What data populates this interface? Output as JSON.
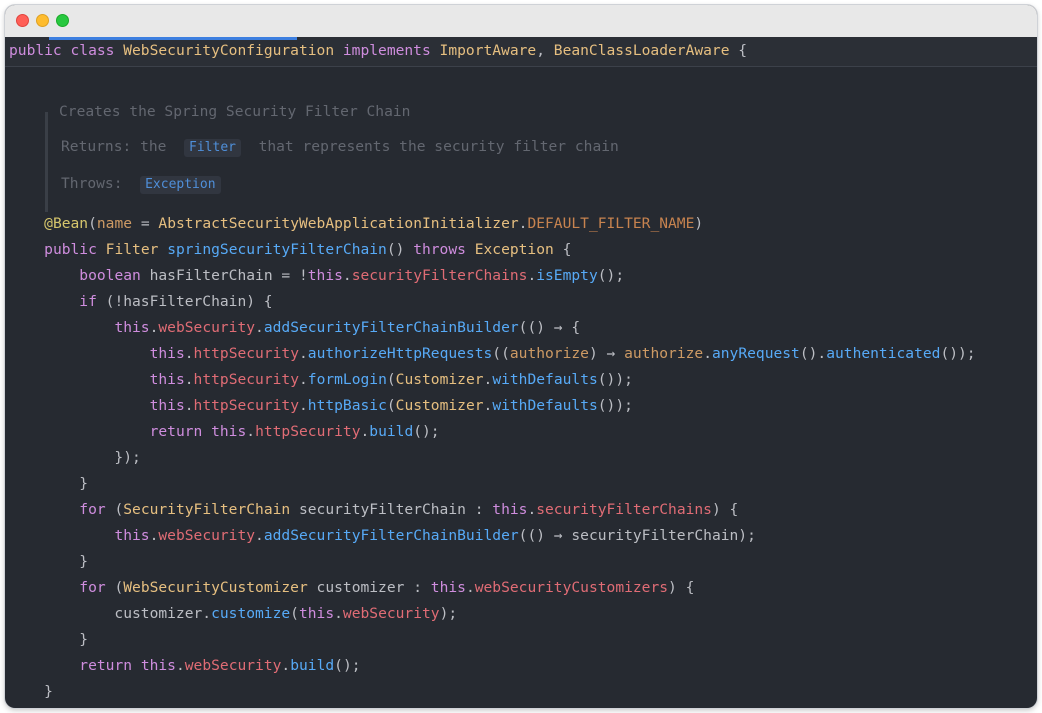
{
  "window": {
    "controls": [
      "close",
      "minimize",
      "zoom"
    ]
  },
  "sticky_header": {
    "tokens": [
      {
        "t": "public class ",
        "c": "kw"
      },
      {
        "t": "WebSecurityConfiguration",
        "c": "cls"
      },
      {
        "t": " implements ",
        "c": "kw"
      },
      {
        "t": "ImportAware",
        "c": "cls"
      },
      {
        "t": ", ",
        "c": "plain"
      },
      {
        "t": "BeanClassLoaderAware",
        "c": "cls"
      },
      {
        "t": " {",
        "c": "plain"
      }
    ]
  },
  "doc": {
    "summary": "Creates the Spring Security Filter Chain",
    "returns_label": "Returns:",
    "returns_pre": "the",
    "returns_chip": "Filter",
    "returns_post": "that represents the security filter chain",
    "throws_label": "Throws:",
    "throws_chip": "Exception"
  },
  "code_lines": [
    [
      {
        "t": "    ",
        "c": "plain"
      },
      {
        "t": "@Bean",
        "c": "ann"
      },
      {
        "t": "(",
        "c": "plain"
      },
      {
        "t": "name",
        "c": "param"
      },
      {
        "t": " = ",
        "c": "plain"
      },
      {
        "t": "AbstractSecurityWebApplicationInitializer",
        "c": "cls"
      },
      {
        "t": ".",
        "c": "plain"
      },
      {
        "t": "DEFAULT_FILTER_NAME",
        "c": "const"
      },
      {
        "t": ")",
        "c": "plain"
      }
    ],
    [
      {
        "t": "    ",
        "c": "plain"
      },
      {
        "t": "public ",
        "c": "kw"
      },
      {
        "t": "Filter",
        "c": "cls"
      },
      {
        "t": " ",
        "c": "plain"
      },
      {
        "t": "springSecurityFilterChain",
        "c": "fn"
      },
      {
        "t": "() ",
        "c": "plain"
      },
      {
        "t": "throws ",
        "c": "kw"
      },
      {
        "t": "Exception",
        "c": "cls"
      },
      {
        "t": " {",
        "c": "plain"
      }
    ],
    [
      {
        "t": "        ",
        "c": "plain"
      },
      {
        "t": "boolean ",
        "c": "kw"
      },
      {
        "t": "hasFilterChain = !",
        "c": "plain"
      },
      {
        "t": "this",
        "c": "kw"
      },
      {
        "t": ".",
        "c": "plain"
      },
      {
        "t": "securityFilterChains",
        "c": "fld2"
      },
      {
        "t": ".",
        "c": "plain"
      },
      {
        "t": "isEmpty",
        "c": "fn"
      },
      {
        "t": "();",
        "c": "plain"
      }
    ],
    [
      {
        "t": "        ",
        "c": "plain"
      },
      {
        "t": "if ",
        "c": "kw"
      },
      {
        "t": "(!hasFilterChain) {",
        "c": "plain"
      }
    ],
    [
      {
        "t": "            ",
        "c": "plain"
      },
      {
        "t": "this",
        "c": "kw"
      },
      {
        "t": ".",
        "c": "plain"
      },
      {
        "t": "webSecurity",
        "c": "fld2"
      },
      {
        "t": ".",
        "c": "plain"
      },
      {
        "t": "addSecurityFilterChainBuilder",
        "c": "fn"
      },
      {
        "t": "(() → {",
        "c": "plain"
      }
    ],
    [
      {
        "t": "                ",
        "c": "plain"
      },
      {
        "t": "this",
        "c": "kw"
      },
      {
        "t": ".",
        "c": "plain"
      },
      {
        "t": "httpSecurity",
        "c": "fld2"
      },
      {
        "t": ".",
        "c": "plain"
      },
      {
        "t": "authorizeHttpRequests",
        "c": "fn"
      },
      {
        "t": "((",
        "c": "plain"
      },
      {
        "t": "authorize",
        "c": "param"
      },
      {
        "t": ") → ",
        "c": "plain"
      },
      {
        "t": "authorize",
        "c": "param"
      },
      {
        "t": ".",
        "c": "plain"
      },
      {
        "t": "anyRequest",
        "c": "fn"
      },
      {
        "t": "().",
        "c": "plain"
      },
      {
        "t": "authenticated",
        "c": "fn"
      },
      {
        "t": "());",
        "c": "plain"
      }
    ],
    [
      {
        "t": "                ",
        "c": "plain"
      },
      {
        "t": "this",
        "c": "kw"
      },
      {
        "t": ".",
        "c": "plain"
      },
      {
        "t": "httpSecurity",
        "c": "fld2"
      },
      {
        "t": ".",
        "c": "plain"
      },
      {
        "t": "formLogin",
        "c": "fn"
      },
      {
        "t": "(",
        "c": "plain"
      },
      {
        "t": "Customizer",
        "c": "cls"
      },
      {
        "t": ".",
        "c": "plain"
      },
      {
        "t": "withDefaults",
        "c": "fn"
      },
      {
        "t": "());",
        "c": "plain"
      }
    ],
    [
      {
        "t": "                ",
        "c": "plain"
      },
      {
        "t": "this",
        "c": "kw"
      },
      {
        "t": ".",
        "c": "plain"
      },
      {
        "t": "httpSecurity",
        "c": "fld2"
      },
      {
        "t": ".",
        "c": "plain"
      },
      {
        "t": "httpBasic",
        "c": "fn"
      },
      {
        "t": "(",
        "c": "plain"
      },
      {
        "t": "Customizer",
        "c": "cls"
      },
      {
        "t": ".",
        "c": "plain"
      },
      {
        "t": "withDefaults",
        "c": "fn"
      },
      {
        "t": "());",
        "c": "plain"
      }
    ],
    [
      {
        "t": "                ",
        "c": "plain"
      },
      {
        "t": "return ",
        "c": "kw"
      },
      {
        "t": "this",
        "c": "kw"
      },
      {
        "t": ".",
        "c": "plain"
      },
      {
        "t": "httpSecurity",
        "c": "fld2"
      },
      {
        "t": ".",
        "c": "plain"
      },
      {
        "t": "build",
        "c": "fn"
      },
      {
        "t": "();",
        "c": "plain"
      }
    ],
    [
      {
        "t": "            });",
        "c": "plain"
      }
    ],
    [
      {
        "t": "        }",
        "c": "plain"
      }
    ],
    [
      {
        "t": "        ",
        "c": "plain"
      },
      {
        "t": "for ",
        "c": "kw"
      },
      {
        "t": "(",
        "c": "plain"
      },
      {
        "t": "SecurityFilterChain",
        "c": "cls"
      },
      {
        "t": " securityFilterChain : ",
        "c": "plain"
      },
      {
        "t": "this",
        "c": "kw"
      },
      {
        "t": ".",
        "c": "plain"
      },
      {
        "t": "securityFilterChains",
        "c": "fld2"
      },
      {
        "t": ") {",
        "c": "plain"
      }
    ],
    [
      {
        "t": "            ",
        "c": "plain"
      },
      {
        "t": "this",
        "c": "kw"
      },
      {
        "t": ".",
        "c": "plain"
      },
      {
        "t": "webSecurity",
        "c": "fld2"
      },
      {
        "t": ".",
        "c": "plain"
      },
      {
        "t": "addSecurityFilterChainBuilder",
        "c": "fn"
      },
      {
        "t": "(() → securityFilterChain);",
        "c": "plain"
      }
    ],
    [
      {
        "t": "        }",
        "c": "plain"
      }
    ],
    [
      {
        "t": "        ",
        "c": "plain"
      },
      {
        "t": "for ",
        "c": "kw"
      },
      {
        "t": "(",
        "c": "plain"
      },
      {
        "t": "WebSecurityCustomizer",
        "c": "cls"
      },
      {
        "t": " customizer : ",
        "c": "plain"
      },
      {
        "t": "this",
        "c": "kw"
      },
      {
        "t": ".",
        "c": "plain"
      },
      {
        "t": "webSecurityCustomizers",
        "c": "fld2"
      },
      {
        "t": ") {",
        "c": "plain"
      }
    ],
    [
      {
        "t": "            customizer.",
        "c": "plain"
      },
      {
        "t": "customize",
        "c": "fn"
      },
      {
        "t": "(",
        "c": "plain"
      },
      {
        "t": "this",
        "c": "kw"
      },
      {
        "t": ".",
        "c": "plain"
      },
      {
        "t": "webSecurity",
        "c": "fld2"
      },
      {
        "t": ");",
        "c": "plain"
      }
    ],
    [
      {
        "t": "        }",
        "c": "plain"
      }
    ],
    [
      {
        "t": "        ",
        "c": "plain"
      },
      {
        "t": "return ",
        "c": "kw"
      },
      {
        "t": "this",
        "c": "kw"
      },
      {
        "t": ".",
        "c": "plain"
      },
      {
        "t": "webSecurity",
        "c": "fld2"
      },
      {
        "t": ".",
        "c": "plain"
      },
      {
        "t": "build",
        "c": "fn"
      },
      {
        "t": "();",
        "c": "plain"
      }
    ],
    [
      {
        "t": "    }",
        "c": "plain"
      }
    ]
  ]
}
